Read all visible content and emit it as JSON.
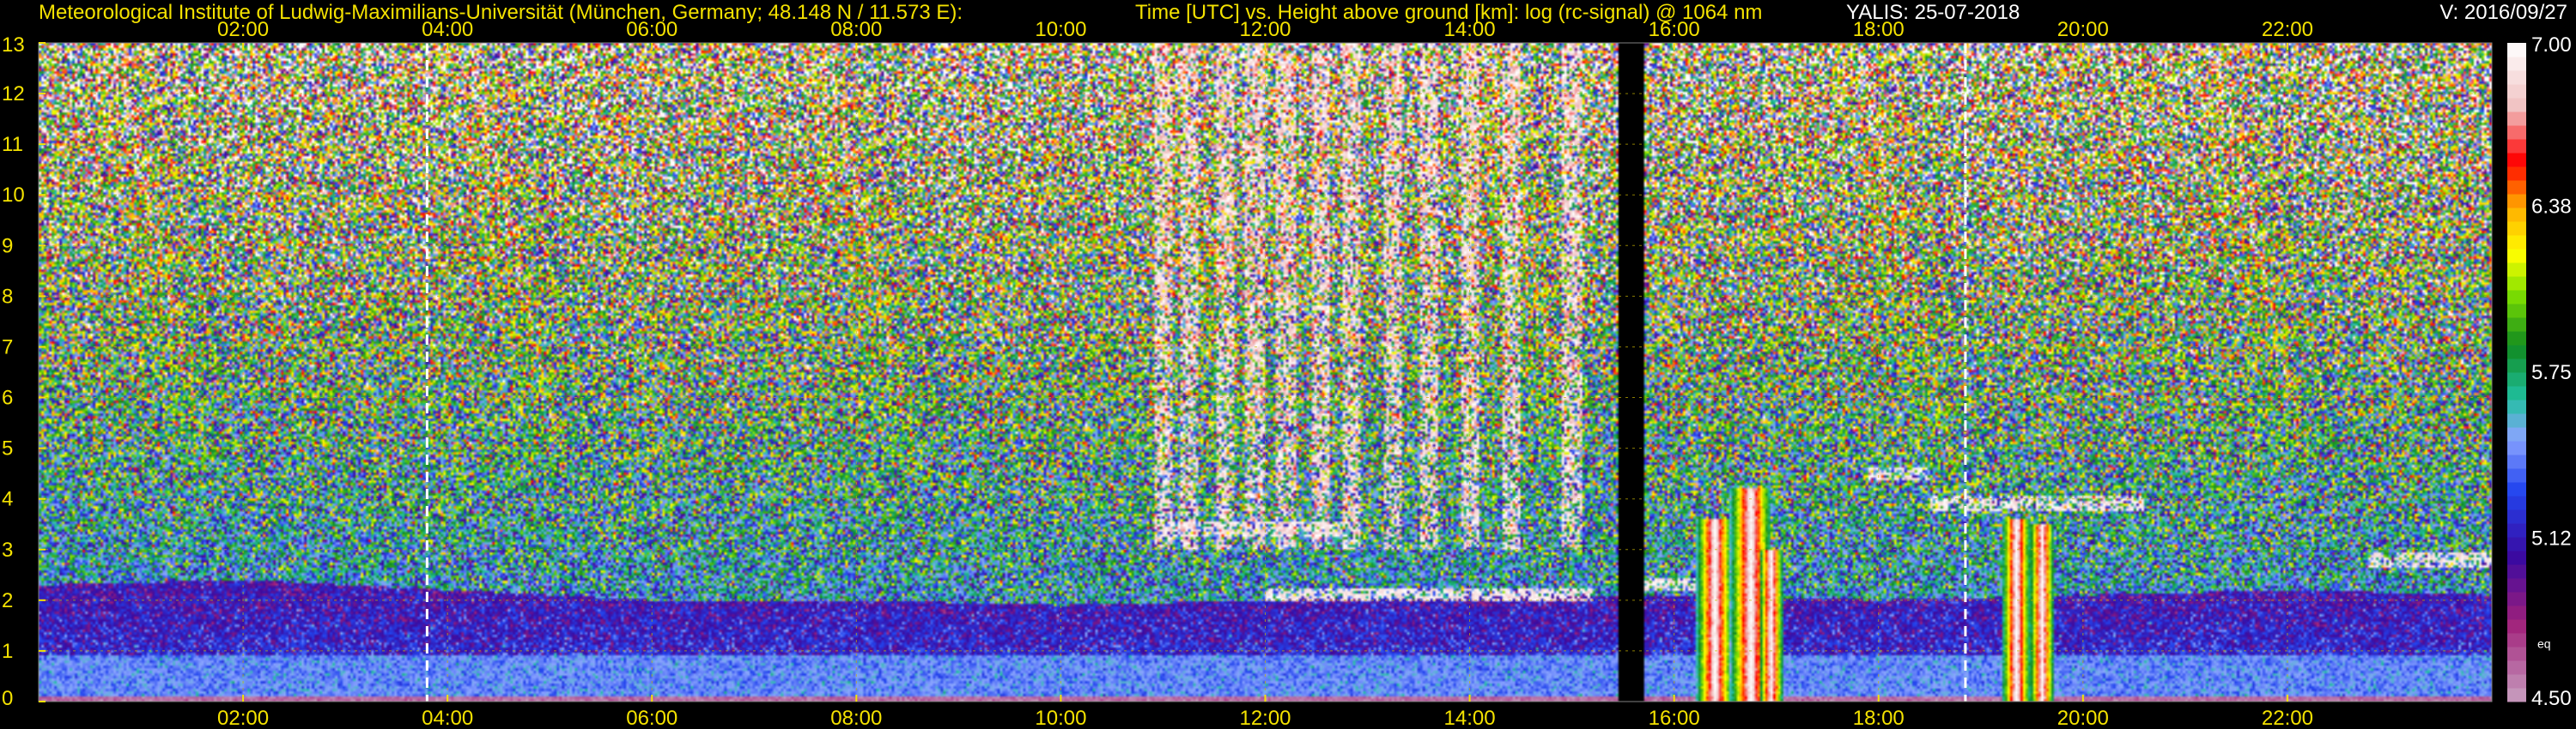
{
  "header": {
    "institute": "Meteorological Institute of Ludwig-Maximilians-Universität (München, Germany; 48.148 N / 11.573 E):",
    "plot_title": "Time [UTC] vs. Height above ground [km]: log (rc-signal) @ 1064 nm",
    "instrument": "YALIS: 25-07-2018",
    "version": "V: 2016/09/27"
  },
  "colors": {
    "background": "#000000",
    "label_yellow": "#f4e200",
    "grid_yellow": "#c8b400",
    "marker_white": "#ffffff"
  },
  "chart_data": {
    "type": "heatmap",
    "title": "Time [UTC] vs. Height above ground [km]: log (rc-signal) @ 1064 nm",
    "xlabel": "Time [UTC]",
    "ylabel": "Height above ground [km]",
    "x_ticks": [
      "02:00",
      "04:00",
      "06:00",
      "08:00",
      "10:00",
      "12:00",
      "14:00",
      "16:00",
      "18:00",
      "20:00",
      "22:00"
    ],
    "x_tick_hours": [
      2,
      4,
      6,
      8,
      10,
      12,
      14,
      16,
      18,
      20,
      22
    ],
    "xlim_hours": [
      0,
      24
    ],
    "y_ticks": [
      0,
      1,
      2,
      3,
      4,
      5,
      6,
      7,
      8,
      9,
      10,
      11,
      12,
      13
    ],
    "ylim_km": [
      0,
      13
    ],
    "grid": true,
    "data_gap_hours": [
      15.45,
      15.7
    ],
    "dashed_markers_hours": [
      3.8,
      18.85
    ],
    "colorbar": {
      "range": [
        4.5,
        7.0
      ],
      "tick_values": [
        7.0,
        6.38,
        5.75,
        5.12,
        4.5
      ],
      "tick_labels": [
        "7.00",
        "6.38",
        "5.75",
        "5.12",
        "4.50"
      ],
      "extra_label": "eq",
      "extra_label_value": 4.72,
      "stops": [
        {
          "v": 4.5,
          "c": "#c8a0c0"
        },
        {
          "v": 4.8,
          "c": "#a0207a"
        },
        {
          "v": 5.05,
          "c": "#3a0aa0"
        },
        {
          "v": 5.3,
          "c": "#2244ee"
        },
        {
          "v": 5.5,
          "c": "#8aa4ff"
        },
        {
          "v": 5.65,
          "c": "#20c0a0"
        },
        {
          "v": 5.85,
          "c": "#108a20"
        },
        {
          "v": 6.05,
          "c": "#80e000"
        },
        {
          "v": 6.2,
          "c": "#ffff00"
        },
        {
          "v": 6.38,
          "c": "#ffaa00"
        },
        {
          "v": 6.55,
          "c": "#ff0000"
        },
        {
          "v": 6.75,
          "c": "#f0c0c0"
        },
        {
          "v": 7.0,
          "c": "#ffffff"
        }
      ]
    },
    "boundary_layer_top_km": [
      {
        "t": 0.0,
        "h": 2.3
      },
      {
        "t": 2.0,
        "h": 2.4
      },
      {
        "t": 4.0,
        "h": 2.2
      },
      {
        "t": 6.0,
        "h": 2.0
      },
      {
        "t": 8.0,
        "h": 2.0
      },
      {
        "t": 10.0,
        "h": 1.9
      },
      {
        "t": 12.0,
        "h": 2.0
      },
      {
        "t": 15.4,
        "h": 2.1
      },
      {
        "t": 18.0,
        "h": 2.0
      },
      {
        "t": 22.0,
        "h": 2.2
      },
      {
        "t": 24.0,
        "h": 2.1
      }
    ],
    "cloud_layers_km": [
      {
        "t0": 11.0,
        "t1": 12.8,
        "h": 3.4
      },
      {
        "t0": 12.0,
        "t1": 15.2,
        "h": 2.1
      },
      {
        "t0": 15.7,
        "t1": 16.5,
        "h": 2.3
      },
      {
        "t0": 17.9,
        "t1": 18.5,
        "h": 4.5
      },
      {
        "t0": 18.5,
        "t1": 20.6,
        "h": 3.9
      },
      {
        "t0": 22.8,
        "t1": 24.0,
        "h": 2.8
      }
    ],
    "convective_columns": [
      {
        "t": 16.4,
        "top_km": 3.6,
        "width_h": 0.18
      },
      {
        "t": 16.75,
        "top_km": 4.2,
        "width_h": 0.2
      },
      {
        "t": 16.95,
        "top_km": 3.0,
        "width_h": 0.12
      },
      {
        "t": 19.35,
        "top_km": 3.6,
        "width_h": 0.14
      },
      {
        "t": 19.6,
        "top_km": 3.5,
        "width_h": 0.12
      }
    ],
    "cirrus_streak_times_hours": [
      11.0,
      11.25,
      11.6,
      11.9,
      12.2,
      12.55,
      12.85,
      13.25,
      13.6,
      14.0,
      14.4,
      15.0
    ]
  }
}
